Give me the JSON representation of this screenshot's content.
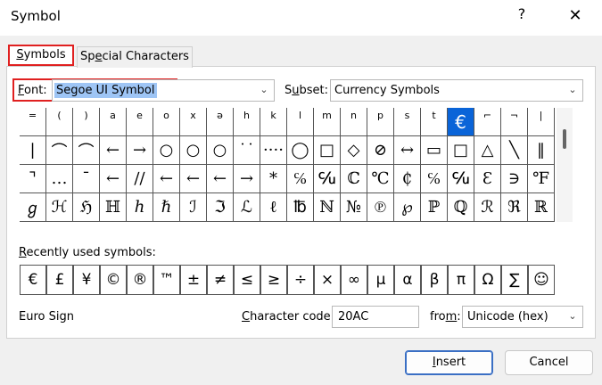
{
  "window": {
    "title": "Symbol",
    "help": "?",
    "close": "✕"
  },
  "tabs": [
    {
      "label_u": "S",
      "label_rest": "ymbols"
    },
    {
      "label_pre": "Sp",
      "label_u": "e",
      "label_rest": "cial Characters"
    }
  ],
  "font": {
    "label_u": "F",
    "label_rest": "ont:",
    "value": "Segoe UI Symbol"
  },
  "subset": {
    "label_pre": "S",
    "label_u": "u",
    "label_rest": "bset:",
    "value": "Currency Symbols"
  },
  "grid_rows": [
    [
      "=",
      "(",
      ")",
      "a",
      "e",
      "o",
      "x",
      "ə",
      "h",
      "k",
      "l",
      "m",
      "n",
      "p",
      "s",
      "t",
      "€",
      "⌐",
      "¬",
      "|"
    ],
    [
      "|",
      "⌒",
      "⌒",
      "←",
      "→",
      "○",
      "○",
      "○",
      "˙˙",
      "····",
      "◯",
      "□",
      "◇",
      "⊘",
      "↔",
      "▭",
      "□",
      "△",
      "╲",
      "‖"
    ],
    [
      "⌝",
      "…",
      "¯",
      "←",
      "∕∕",
      "←",
      "←",
      "←",
      "→",
      "*",
      "℅",
      "℆",
      "ℂ",
      "℃",
      "₵",
      "℅",
      "℆",
      "Ɛ",
      "∋",
      "℉"
    ],
    [
      "ℊ",
      "ℋ",
      "ℌ",
      "ℍ",
      "ℎ",
      "ℏ",
      "ℐ",
      "ℑ",
      "ℒ",
      "ℓ",
      "℔",
      "ℕ",
      "№",
      "℗",
      "℘",
      "ℙ",
      "ℚ",
      "ℛ",
      "ℜ",
      "ℝ"
    ]
  ],
  "recent": {
    "label_u": "R",
    "label_rest": "ecently used symbols:",
    "symbols": [
      "€",
      "£",
      "¥",
      "©",
      "®",
      "™",
      "±",
      "≠",
      "≤",
      "≥",
      "÷",
      "×",
      "∞",
      "µ",
      "α",
      "β",
      "π",
      "Ω",
      "∑",
      "☺"
    ]
  },
  "char_name": "Euro Sign",
  "code": {
    "label_pre": "",
    "label_u": "C",
    "label_rest": "haracter code:",
    "value": "20AC"
  },
  "from": {
    "label_pre": "fro",
    "label_u": "m",
    "label_rest": ":",
    "value": "Unicode (hex)"
  },
  "buttons": {
    "insert_u": "I",
    "insert_rest": "nsert",
    "cancel": "Cancel"
  },
  "colors": {
    "highlight_red": "#e02020",
    "selection_blue": "#0a64d8",
    "text_select": "#9ec5f5"
  }
}
